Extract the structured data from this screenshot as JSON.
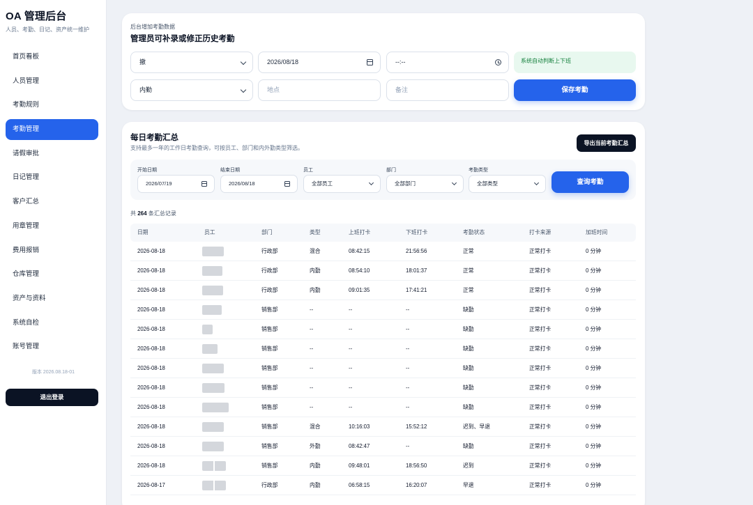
{
  "sidebar": {
    "brand": "OA 管理后台",
    "subtitle": "人员、考勤、日记、资产统一维护",
    "items": [
      {
        "label": "首页看板"
      },
      {
        "label": "人员管理"
      },
      {
        "label": "考勤规则"
      },
      {
        "label": "考勤管理",
        "active": true
      },
      {
        "label": "请假审批"
      },
      {
        "label": "日记管理"
      },
      {
        "label": "客户汇总"
      },
      {
        "label": "用章管理"
      },
      {
        "label": "费用报销"
      },
      {
        "label": "仓库管理"
      },
      {
        "label": "资产与资料"
      },
      {
        "label": "系统自检"
      },
      {
        "label": "账号管理"
      }
    ],
    "version": "版本 2026.08.18-01",
    "logout_label": "退出登录"
  },
  "add_form": {
    "eyebrow": "后台增加考勤数据",
    "title": "管理员可补录或修正历史考勤",
    "type_value": "撤",
    "date_value": "2026/08/18",
    "time_value": "--:--",
    "hint": "系统自动判断上下班",
    "mode_value": "内勤",
    "location_placeholder": "地点",
    "note_placeholder": "备注",
    "save_label": "保存考勤"
  },
  "summary": {
    "title": "每日考勤汇总",
    "subtitle": "支持最多一年的工作日考勤查询，可按员工、部门和内外勤类型筛选。",
    "export_label": "导出当前考勤汇总",
    "filters": {
      "start_label": "开始日期",
      "start_value": "2026/07/19",
      "end_label": "结束日期",
      "end_value": "2026/08/18",
      "employee_label": "员工",
      "employee_value": "全部员工",
      "dept_label": "部门",
      "dept_value": "全部部门",
      "type_label": "考勤类型",
      "type_value": "全部类型",
      "query_label": "查询考勤"
    },
    "count_prefix": "共",
    "count": "264",
    "count_suffix": "条汇总记录",
    "columns": [
      "日期",
      "员工",
      "部门",
      "类型",
      "上班打卡",
      "下班打卡",
      "考勤状态",
      "打卡来源",
      "加班时间"
    ],
    "rows": [
      {
        "date": "2026-08-18",
        "dept": "行政部",
        "type": "混合",
        "in": "08:42:15",
        "out": "21:56:56",
        "status": "正常",
        "source": "正常打卡",
        "ot": "0 分钟"
      },
      {
        "date": "2026-08-18",
        "dept": "行政部",
        "type": "内勤",
        "in": "08:54:10",
        "out": "18:01:37",
        "status": "正常",
        "source": "正常打卡",
        "ot": "0 分钟"
      },
      {
        "date": "2026-08-18",
        "dept": "行政部",
        "type": "内勤",
        "in": "09:01:35",
        "out": "17:41:21",
        "status": "正常",
        "source": "正常打卡",
        "ot": "0 分钟"
      },
      {
        "date": "2026-08-18",
        "dept": "销售部",
        "type": "--",
        "in": "--",
        "out": "--",
        "status": "缺勤",
        "source": "正常打卡",
        "ot": "0 分钟"
      },
      {
        "date": "2026-08-18",
        "dept": "销售部",
        "type": "--",
        "in": "--",
        "out": "--",
        "status": "缺勤",
        "source": "正常打卡",
        "ot": "0 分钟"
      },
      {
        "date": "2026-08-18",
        "dept": "销售部",
        "type": "--",
        "in": "--",
        "out": "--",
        "status": "缺勤",
        "source": "正常打卡",
        "ot": "0 分钟"
      },
      {
        "date": "2026-08-18",
        "dept": "销售部",
        "type": "--",
        "in": "--",
        "out": "--",
        "status": "缺勤",
        "source": "正常打卡",
        "ot": "0 分钟"
      },
      {
        "date": "2026-08-18",
        "dept": "销售部",
        "type": "--",
        "in": "--",
        "out": "--",
        "status": "缺勤",
        "source": "正常打卡",
        "ot": "0 分钟"
      },
      {
        "date": "2026-08-18",
        "dept": "销售部",
        "type": "--",
        "in": "--",
        "out": "--",
        "status": "缺勤",
        "source": "正常打卡",
        "ot": "0 分钟"
      },
      {
        "date": "2026-08-18",
        "dept": "销售部",
        "type": "混合",
        "in": "10:16:03",
        "out": "15:52:12",
        "status": "迟到、早退",
        "source": "正常打卡",
        "ot": "0 分钟"
      },
      {
        "date": "2026-08-18",
        "dept": "销售部",
        "type": "外勤",
        "in": "08:42:47",
        "out": "--",
        "status": "缺勤",
        "source": "正常打卡",
        "ot": "0 分钟"
      },
      {
        "date": "2026-08-18",
        "dept": "销售部",
        "type": "内勤",
        "in": "09:48:01",
        "out": "18:56:50",
        "status": "迟到",
        "source": "正常打卡",
        "ot": "0 分钟"
      },
      {
        "date": "2026-08-17",
        "dept": "行政部",
        "type": "内勤",
        "in": "06:58:15",
        "out": "16:20:07",
        "status": "早退",
        "source": "正常打卡",
        "ot": "0 分钟"
      }
    ]
  }
}
